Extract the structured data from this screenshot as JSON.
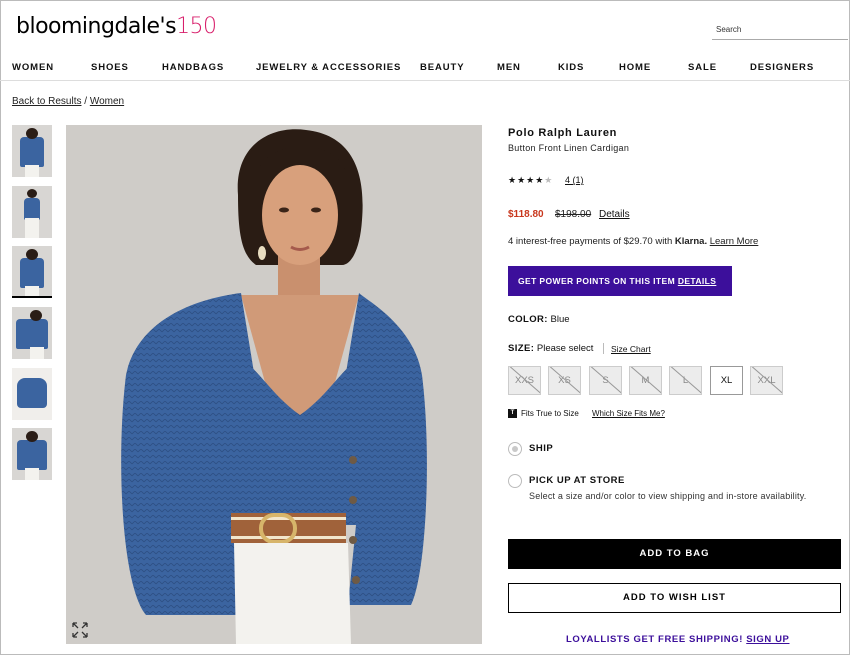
{
  "header": {
    "logo_text": "bloomingdale's",
    "logo_number": "150",
    "search_placeholder": "Search",
    "nav": [
      "WOMEN",
      "SHOES",
      "HANDBAGS",
      "JEWELRY & ACCESSORIES",
      "BEAUTY",
      "MEN",
      "KIDS",
      "HOME",
      "SALE",
      "DESIGNERS"
    ]
  },
  "breadcrumb": {
    "back": "Back to Results",
    "separator": "/",
    "category": "Women"
  },
  "gallery": {
    "thumbnails": 6,
    "selected_index": 2
  },
  "product": {
    "brand": "Polo Ralph Lauren",
    "name": "Button Front Linen Cardigan",
    "stars_filled": "★★★★",
    "stars_empty": "★",
    "rating_link": "4 (1)",
    "sale_price": "$118.80",
    "original_price": "$198.00",
    "price_details_link": "Details",
    "klarna_text": "4 interest-free payments of $29.70 with ",
    "klarna_brand": "Klarna.",
    "klarna_link": "Learn More",
    "power_points_text": "GET POWER POINTS ON THIS ITEM ",
    "power_points_link": "DETAILS",
    "color_label": "COLOR:",
    "color_value": "Blue",
    "size_label": "SIZE:",
    "size_value": "Please select",
    "size_chart_link": "Size Chart",
    "sizes": [
      {
        "label": "XXS",
        "available": false
      },
      {
        "label": "XS",
        "available": false
      },
      {
        "label": "S",
        "available": false
      },
      {
        "label": "M",
        "available": false
      },
      {
        "label": "L",
        "available": false
      },
      {
        "label": "XL",
        "available": true
      },
      {
        "label": "XXL",
        "available": false
      }
    ],
    "fit_icon_letter": "T",
    "fit_text": "Fits True to Size",
    "fit_link": "Which Size Fits Me?",
    "ship_label": "SHIP",
    "pickup_label": "PICK UP AT STORE",
    "pickup_note": "Select a size and/or color to view shipping and in-store availability.",
    "add_to_bag": "ADD TO BAG",
    "add_to_wishlist": "ADD TO WISH LIST",
    "loyalty_text": "LOYALLISTS GET FREE SHIPPING! ",
    "loyalty_link": "SIGN UP"
  },
  "colors": {
    "sale_red": "#c8361c",
    "power_purple": "#3c0f9b",
    "logo_pink": "#d81f6b",
    "cardigan_blue": "#3b64a0"
  }
}
